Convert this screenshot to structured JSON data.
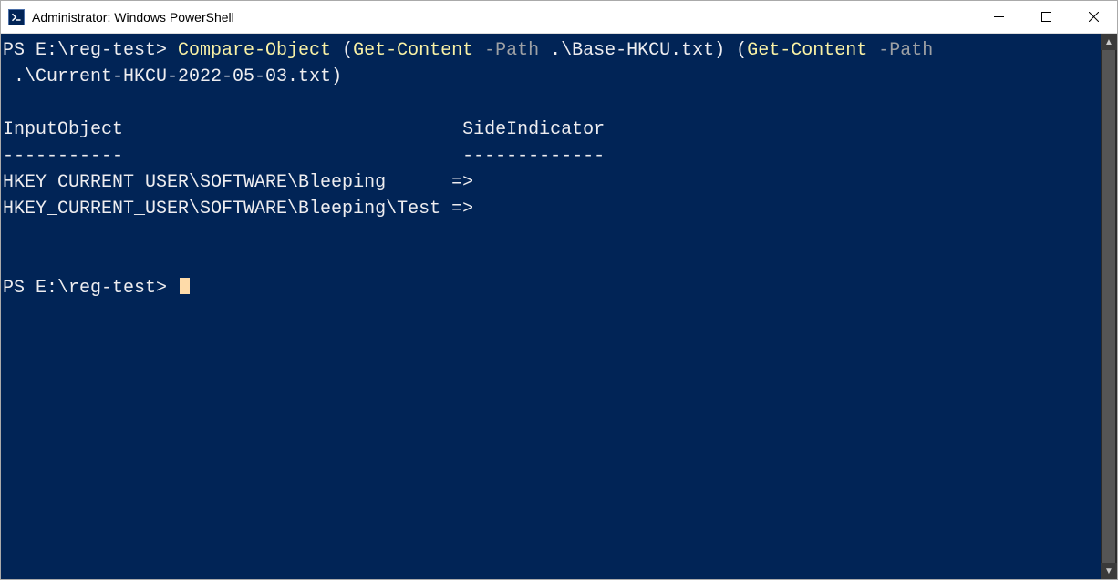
{
  "window": {
    "title": "Administrator: Windows PowerShell"
  },
  "terminal": {
    "prompt1": "PS E:\\reg-test> ",
    "cmd": {
      "compare": "Compare-Object",
      "paren1": " (",
      "get1": "Get-Content",
      "space1": " ",
      "path1": "-Path",
      "arg1": " .\\Base-HKCU.txt",
      "paren2": ") (",
      "get2": "Get-Content",
      "space2": " ",
      "path2": "-Path",
      "line2": " .\\Current-HKCU-2022-05-03.txt",
      "paren3": ")"
    },
    "blank1": "",
    "header": "InputObject                               SideIndicator",
    "divider": "-----------                               -------------",
    "row1": "HKEY_CURRENT_USER\\SOFTWARE\\Bleeping      =>",
    "row2": "HKEY_CURRENT_USER\\SOFTWARE\\Bleeping\\Test =>",
    "blank2": "",
    "blank3": "",
    "prompt2": "PS E:\\reg-test> "
  }
}
